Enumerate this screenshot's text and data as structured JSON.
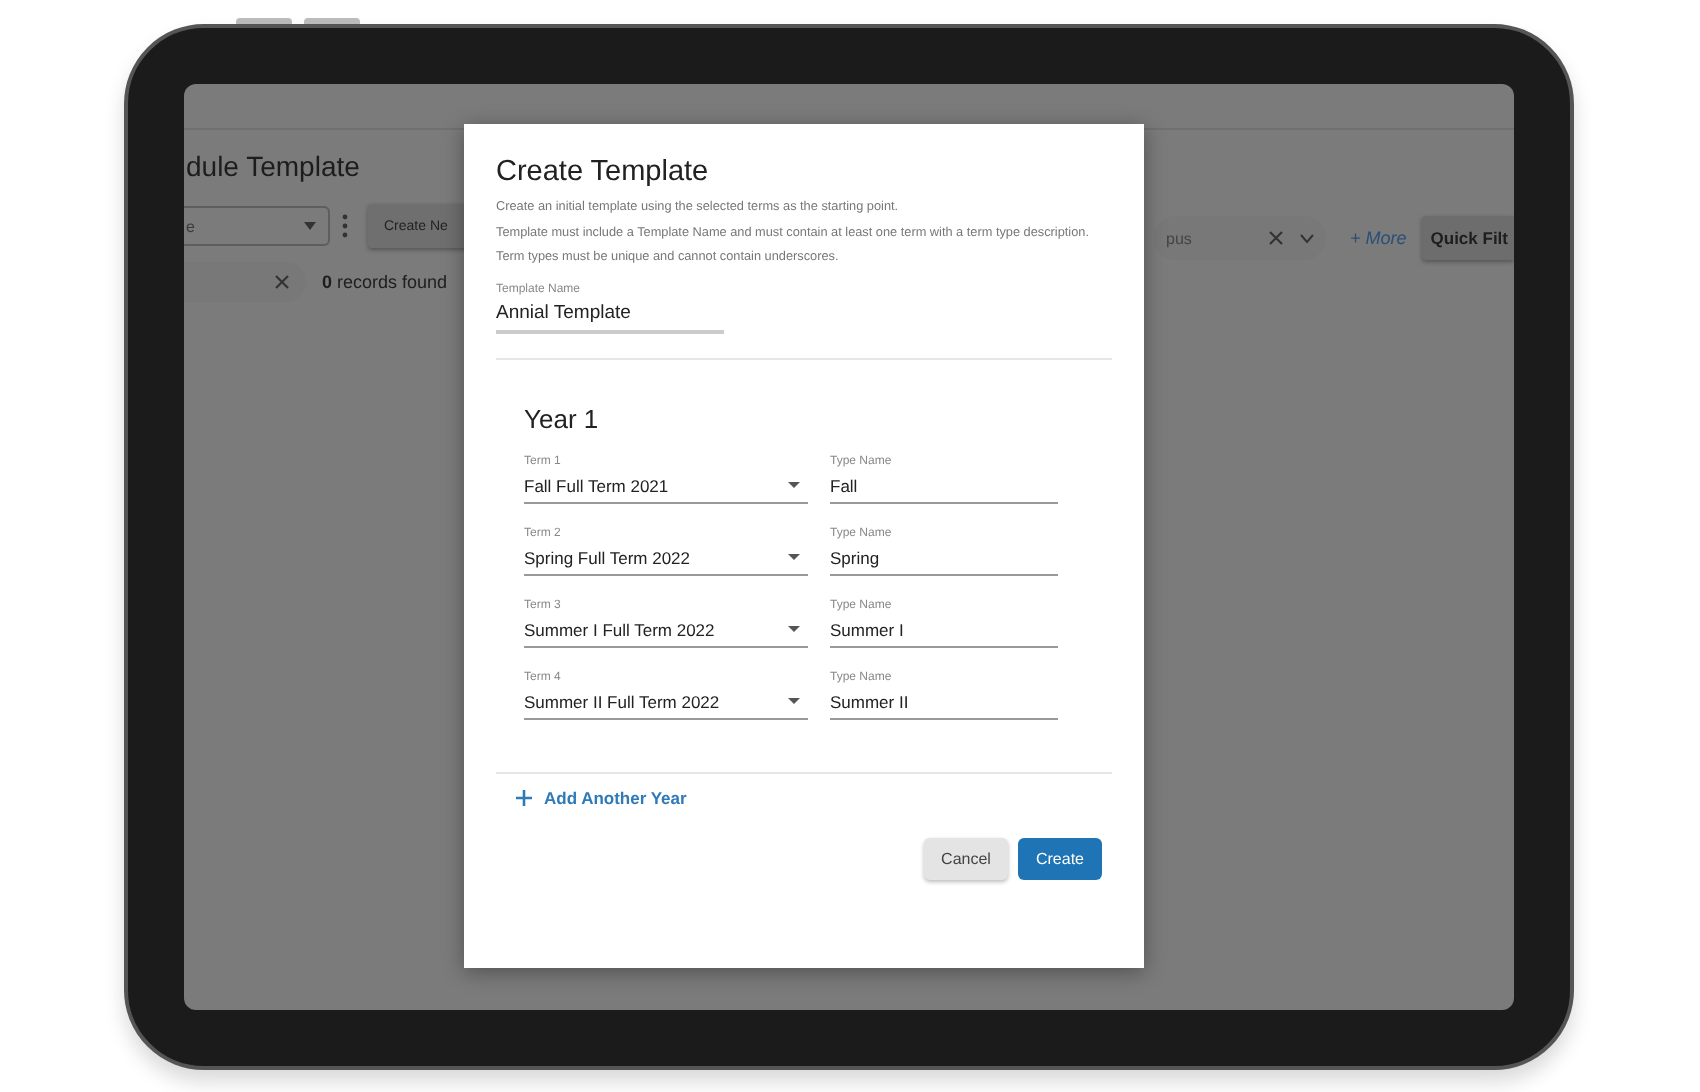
{
  "background": {
    "page_title": "dule Template",
    "dropdown_value": "e",
    "create_button": "Create Ne",
    "records": "**0** records found",
    "filter_value": "pus",
    "more_link": "+ More",
    "quick_filter_button": "Quick Filt"
  },
  "dialog": {
    "title": "Create Template",
    "description": [
      "Create an initial template using the selected terms as the starting point.",
      "Template must include a Template Name and must contain at least one term with a term type description. Term types must be unique and cannot contain underscores."
    ],
    "template_name": {
      "label": "Template Name",
      "value": "Annial Template"
    },
    "years": [
      {
        "title": "Year 1",
        "terms": [
          {
            "label": "Term 1",
            "value": "Fall Full Term 2021",
            "type_label": "Type Name",
            "type_value": "Fall"
          },
          {
            "label": "Term 2",
            "value": "Spring Full Term 2022",
            "type_label": "Type Name",
            "type_value": "Spring"
          },
          {
            "label": "Term 3",
            "value": "Summer I Full Term 2022",
            "type_label": "Type Name",
            "type_value": "Summer I"
          },
          {
            "label": "Term 4",
            "value": "Summer II Full Term 2022",
            "type_label": "Type Name",
            "type_value": "Summer II"
          }
        ]
      }
    ],
    "add_year": "Add Another Year",
    "buttons": {
      "cancel": "Cancel",
      "create": "Create"
    }
  }
}
